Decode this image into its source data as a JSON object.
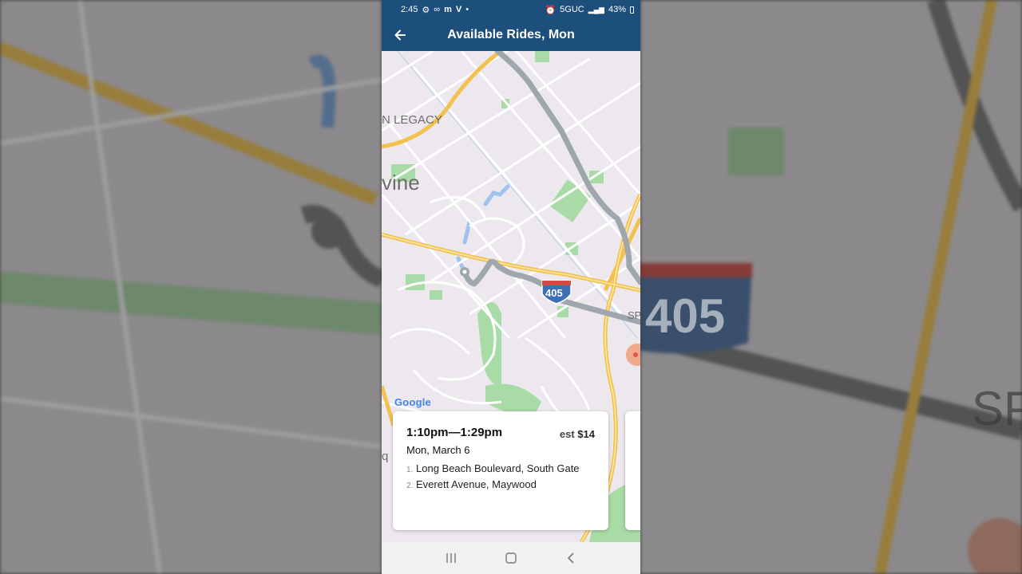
{
  "status_bar": {
    "time": "2:45",
    "network": "5GUC",
    "battery": "43%",
    "icons": [
      "settings-icon",
      "voicemail-icon",
      "messages-icon",
      "app-icon",
      "dot-icon",
      "alarm-icon",
      "signal-icon",
      "battery-icon"
    ]
  },
  "header": {
    "title": "Available Rides, Mon",
    "back_icon": "arrow-left-icon"
  },
  "map": {
    "labels": {
      "legacy": "N LEGACY",
      "irvine": "vine",
      "highway": "405",
      "sp": "SP",
      "partial_q": "q"
    },
    "attribution": "Google",
    "colors": {
      "route": "#9ea6ae",
      "highway": "#f7c94a",
      "park": "#a8dba6",
      "water": "#9ec3f0",
      "land": "#ece8ee"
    }
  },
  "ride_card": {
    "time_range": "1:10pm—1:29pm",
    "price_prefix": "est",
    "price": "$14",
    "date": "Mon, March 6",
    "stops": [
      {
        "num": "1.",
        "name": "Long Beach Boulevard, South Gate"
      },
      {
        "num": "2.",
        "name": "Everett Avenue, Maywood"
      }
    ]
  },
  "nav_bar": {
    "icons": [
      "recent-apps-icon",
      "home-icon",
      "back-icon"
    ]
  },
  "colors": {
    "app_bar": "#1d4f7c",
    "card": "#ffffff"
  }
}
